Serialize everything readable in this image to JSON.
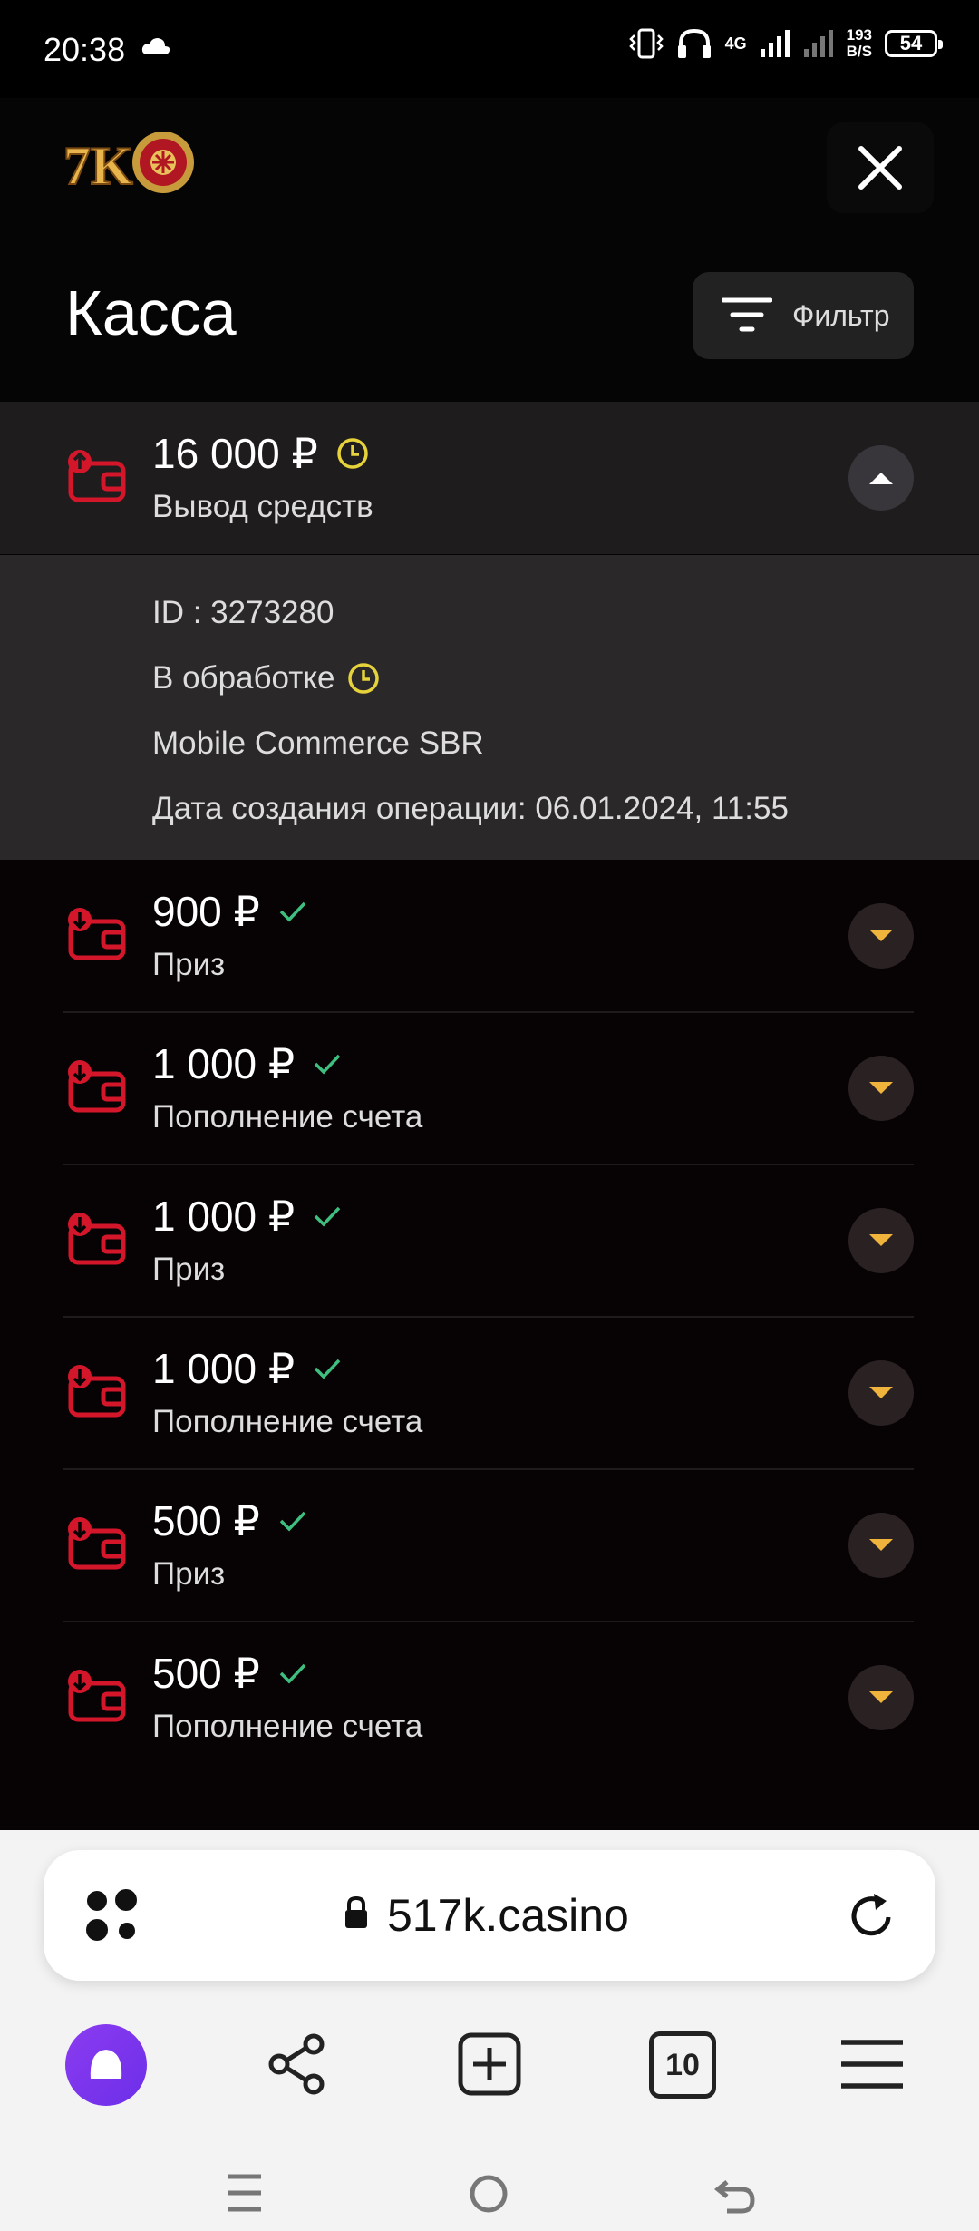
{
  "status_bar": {
    "time": "20:38",
    "speed_top": "193",
    "speed_bottom": "B/S",
    "battery": "54",
    "network": "4G"
  },
  "header": {
    "title": "Касса",
    "filter_label": "Фильтр",
    "logo_text": "7K"
  },
  "transactions": [
    {
      "amount": "16 000 ₽",
      "type": "Вывод средств",
      "status": "pending",
      "expanded": true
    },
    {
      "amount": "900 ₽",
      "type": "Приз",
      "status": "done"
    },
    {
      "amount": "1 000 ₽",
      "type": "Пополнение счета",
      "status": "done"
    },
    {
      "amount": "1 000 ₽",
      "type": "Приз",
      "status": "done"
    },
    {
      "amount": "1 000 ₽",
      "type": "Пополнение счета",
      "status": "done"
    },
    {
      "amount": "500 ₽",
      "type": "Приз",
      "status": "done"
    },
    {
      "amount": "500 ₽",
      "type": "Пополнение счета",
      "status": "done"
    }
  ],
  "details": {
    "id": "ID : 3273280",
    "status": "В обработке",
    "method": "Mobile Commerce SBR",
    "created": "Дата создания операции: 06.01.2024, 11:55"
  },
  "browser": {
    "url": "517k.casino",
    "tabs_count": "10"
  },
  "colors": {
    "accent_red": "#d4162a",
    "pending_yellow": "#e6d23a",
    "done_green": "#3fbf7f",
    "toggle_orange": "#f0b43c"
  }
}
